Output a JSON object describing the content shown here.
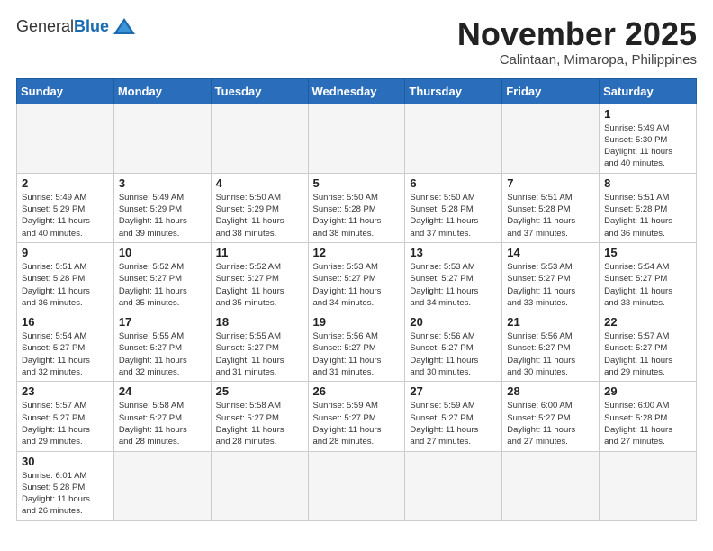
{
  "header": {
    "logo_general": "General",
    "logo_blue": "Blue",
    "month_title": "November 2025",
    "location": "Calintaan, Mimaropa, Philippines"
  },
  "weekdays": [
    "Sunday",
    "Monday",
    "Tuesday",
    "Wednesday",
    "Thursday",
    "Friday",
    "Saturday"
  ],
  "weeks": [
    [
      {
        "day": "",
        "info": ""
      },
      {
        "day": "",
        "info": ""
      },
      {
        "day": "",
        "info": ""
      },
      {
        "day": "",
        "info": ""
      },
      {
        "day": "",
        "info": ""
      },
      {
        "day": "",
        "info": ""
      },
      {
        "day": "1",
        "info": "Sunrise: 5:49 AM\nSunset: 5:30 PM\nDaylight: 11 hours\nand 40 minutes."
      }
    ],
    [
      {
        "day": "2",
        "info": "Sunrise: 5:49 AM\nSunset: 5:29 PM\nDaylight: 11 hours\nand 40 minutes."
      },
      {
        "day": "3",
        "info": "Sunrise: 5:49 AM\nSunset: 5:29 PM\nDaylight: 11 hours\nand 39 minutes."
      },
      {
        "day": "4",
        "info": "Sunrise: 5:50 AM\nSunset: 5:29 PM\nDaylight: 11 hours\nand 38 minutes."
      },
      {
        "day": "5",
        "info": "Sunrise: 5:50 AM\nSunset: 5:28 PM\nDaylight: 11 hours\nand 38 minutes."
      },
      {
        "day": "6",
        "info": "Sunrise: 5:50 AM\nSunset: 5:28 PM\nDaylight: 11 hours\nand 37 minutes."
      },
      {
        "day": "7",
        "info": "Sunrise: 5:51 AM\nSunset: 5:28 PM\nDaylight: 11 hours\nand 37 minutes."
      },
      {
        "day": "8",
        "info": "Sunrise: 5:51 AM\nSunset: 5:28 PM\nDaylight: 11 hours\nand 36 minutes."
      }
    ],
    [
      {
        "day": "9",
        "info": "Sunrise: 5:51 AM\nSunset: 5:28 PM\nDaylight: 11 hours\nand 36 minutes."
      },
      {
        "day": "10",
        "info": "Sunrise: 5:52 AM\nSunset: 5:27 PM\nDaylight: 11 hours\nand 35 minutes."
      },
      {
        "day": "11",
        "info": "Sunrise: 5:52 AM\nSunset: 5:27 PM\nDaylight: 11 hours\nand 35 minutes."
      },
      {
        "day": "12",
        "info": "Sunrise: 5:53 AM\nSunset: 5:27 PM\nDaylight: 11 hours\nand 34 minutes."
      },
      {
        "day": "13",
        "info": "Sunrise: 5:53 AM\nSunset: 5:27 PM\nDaylight: 11 hours\nand 34 minutes."
      },
      {
        "day": "14",
        "info": "Sunrise: 5:53 AM\nSunset: 5:27 PM\nDaylight: 11 hours\nand 33 minutes."
      },
      {
        "day": "15",
        "info": "Sunrise: 5:54 AM\nSunset: 5:27 PM\nDaylight: 11 hours\nand 33 minutes."
      }
    ],
    [
      {
        "day": "16",
        "info": "Sunrise: 5:54 AM\nSunset: 5:27 PM\nDaylight: 11 hours\nand 32 minutes."
      },
      {
        "day": "17",
        "info": "Sunrise: 5:55 AM\nSunset: 5:27 PM\nDaylight: 11 hours\nand 32 minutes."
      },
      {
        "day": "18",
        "info": "Sunrise: 5:55 AM\nSunset: 5:27 PM\nDaylight: 11 hours\nand 31 minutes."
      },
      {
        "day": "19",
        "info": "Sunrise: 5:56 AM\nSunset: 5:27 PM\nDaylight: 11 hours\nand 31 minutes."
      },
      {
        "day": "20",
        "info": "Sunrise: 5:56 AM\nSunset: 5:27 PM\nDaylight: 11 hours\nand 30 minutes."
      },
      {
        "day": "21",
        "info": "Sunrise: 5:56 AM\nSunset: 5:27 PM\nDaylight: 11 hours\nand 30 minutes."
      },
      {
        "day": "22",
        "info": "Sunrise: 5:57 AM\nSunset: 5:27 PM\nDaylight: 11 hours\nand 29 minutes."
      }
    ],
    [
      {
        "day": "23",
        "info": "Sunrise: 5:57 AM\nSunset: 5:27 PM\nDaylight: 11 hours\nand 29 minutes."
      },
      {
        "day": "24",
        "info": "Sunrise: 5:58 AM\nSunset: 5:27 PM\nDaylight: 11 hours\nand 28 minutes."
      },
      {
        "day": "25",
        "info": "Sunrise: 5:58 AM\nSunset: 5:27 PM\nDaylight: 11 hours\nand 28 minutes."
      },
      {
        "day": "26",
        "info": "Sunrise: 5:59 AM\nSunset: 5:27 PM\nDaylight: 11 hours\nand 28 minutes."
      },
      {
        "day": "27",
        "info": "Sunrise: 5:59 AM\nSunset: 5:27 PM\nDaylight: 11 hours\nand 27 minutes."
      },
      {
        "day": "28",
        "info": "Sunrise: 6:00 AM\nSunset: 5:27 PM\nDaylight: 11 hours\nand 27 minutes."
      },
      {
        "day": "29",
        "info": "Sunrise: 6:00 AM\nSunset: 5:28 PM\nDaylight: 11 hours\nand 27 minutes."
      }
    ],
    [
      {
        "day": "30",
        "info": "Sunrise: 6:01 AM\nSunset: 5:28 PM\nDaylight: 11 hours\nand 26 minutes."
      },
      {
        "day": "",
        "info": ""
      },
      {
        "day": "",
        "info": ""
      },
      {
        "day": "",
        "info": ""
      },
      {
        "day": "",
        "info": ""
      },
      {
        "day": "",
        "info": ""
      },
      {
        "day": "",
        "info": ""
      }
    ]
  ]
}
